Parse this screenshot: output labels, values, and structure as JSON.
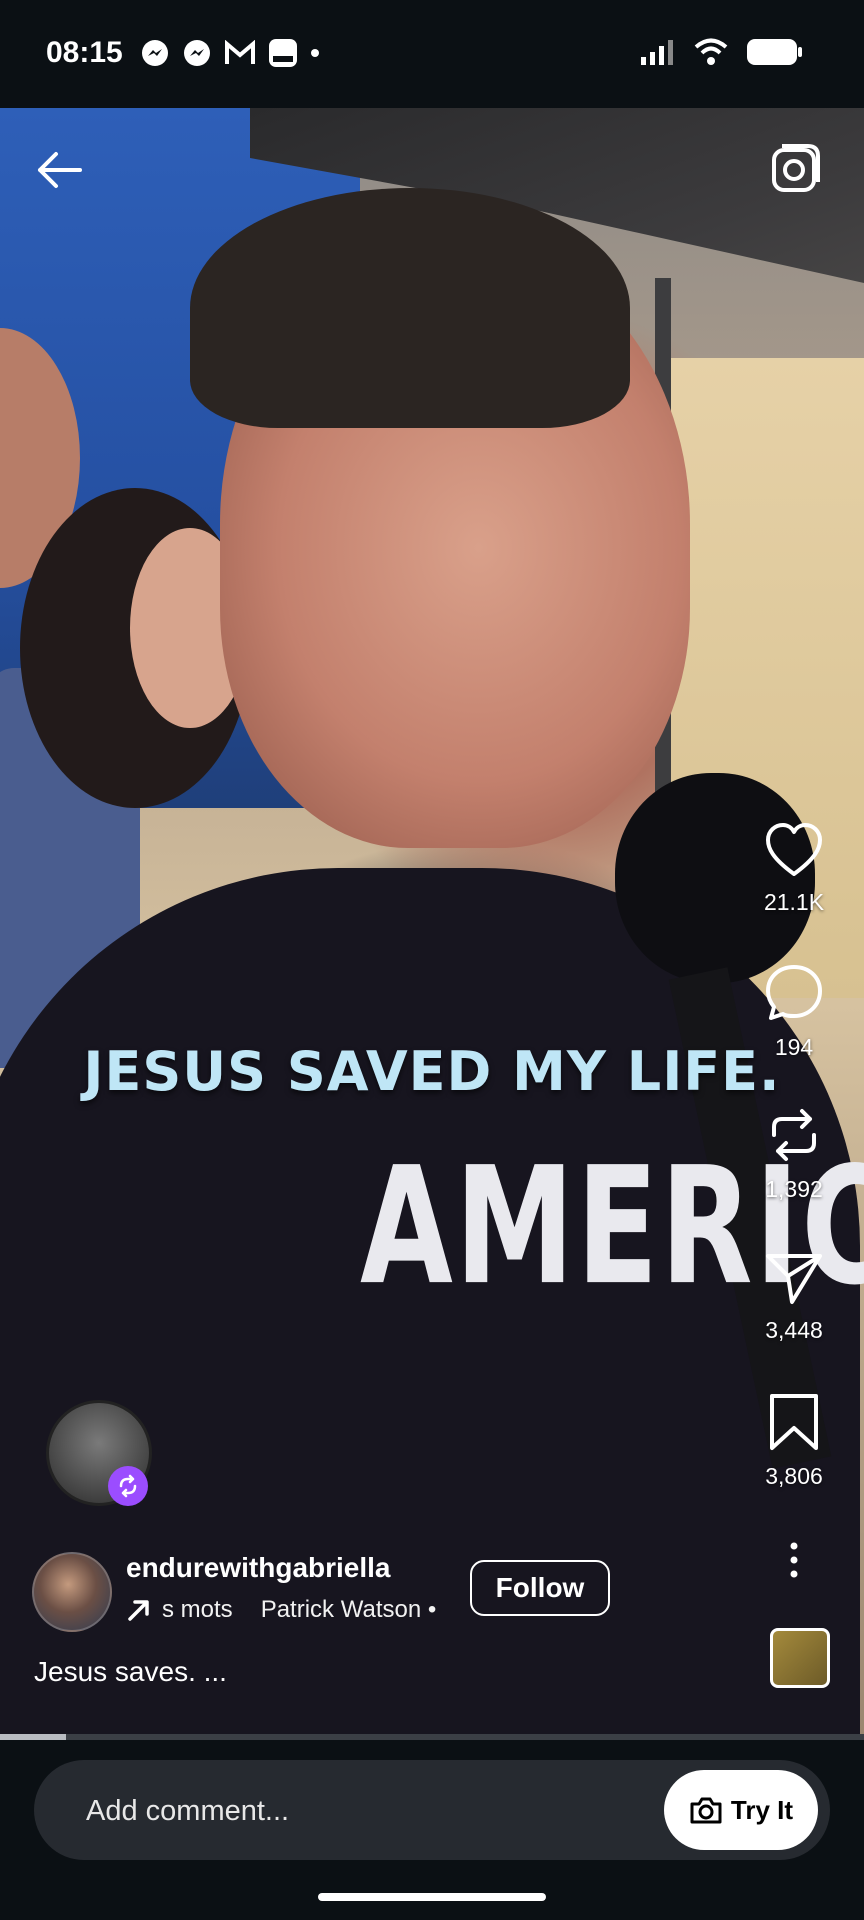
{
  "status_bar": {
    "time": "08:15"
  },
  "video": {
    "caption": "JESUS SAVED MY LIFE.",
    "shirt_text": "AMERICAN"
  },
  "actions": [
    {
      "icon": "heart-icon",
      "count": "21.1K"
    },
    {
      "icon": "comment-icon",
      "count": "194"
    },
    {
      "icon": "repost-icon",
      "count": "1,392"
    },
    {
      "icon": "send-icon",
      "count": "3,448"
    },
    {
      "icon": "bookmark-icon",
      "count": "3,806"
    }
  ],
  "post": {
    "username": "endurewithgabriella",
    "audio_snippet": "s mots",
    "audio_artist": "Patrick Watson •",
    "follow_label": "Follow",
    "description": "Jesus saves. ..."
  },
  "progress": {
    "played_fraction": 0.076
  },
  "comment_bar": {
    "placeholder": "Add comment...",
    "try_it_label": "Try It"
  },
  "colors": {
    "background": "#0b1014",
    "caption": "#bfe6f6",
    "remix_badge": "#9b4dff"
  }
}
